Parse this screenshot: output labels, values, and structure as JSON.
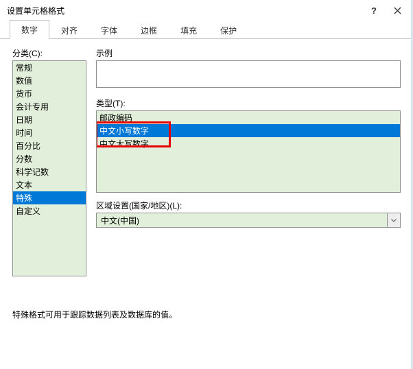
{
  "title": "设置单元格格式",
  "tabs": [
    {
      "label": "数字",
      "active": true
    },
    {
      "label": "对齐",
      "active": false
    },
    {
      "label": "字体",
      "active": false
    },
    {
      "label": "边框",
      "active": false
    },
    {
      "label": "填充",
      "active": false
    },
    {
      "label": "保护",
      "active": false
    }
  ],
  "labels": {
    "category": "分类(C):",
    "sample": "示例",
    "type": "类型(T):",
    "locale": "区域设置(国家/地区)(L):"
  },
  "categories": [
    {
      "label": "常规",
      "selected": false
    },
    {
      "label": "数值",
      "selected": false
    },
    {
      "label": "货币",
      "selected": false
    },
    {
      "label": "会计专用",
      "selected": false
    },
    {
      "label": "日期",
      "selected": false
    },
    {
      "label": "时间",
      "selected": false
    },
    {
      "label": "百分比",
      "selected": false
    },
    {
      "label": "分数",
      "selected": false
    },
    {
      "label": "科学记数",
      "selected": false
    },
    {
      "label": "文本",
      "selected": false
    },
    {
      "label": "特殊",
      "selected": true
    },
    {
      "label": "自定义",
      "selected": false
    }
  ],
  "types": [
    {
      "label": "邮政编码",
      "selected": false
    },
    {
      "label": "中文小写数字",
      "selected": true
    },
    {
      "label": "中文大写数字",
      "selected": false
    }
  ],
  "locale_value": "中文(中国)",
  "hint": "特殊格式可用于跟踪数据列表及数据库的值。"
}
